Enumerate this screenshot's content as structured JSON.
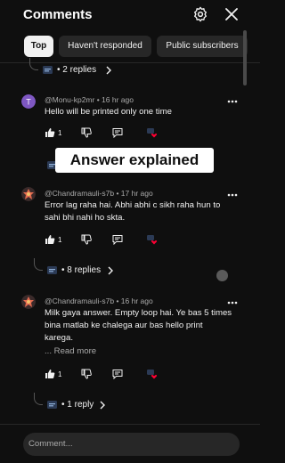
{
  "header": {
    "title": "Comments",
    "settings_icon": "gear-icon",
    "close_icon": "close-icon"
  },
  "tabs": [
    {
      "label": "Top"
    },
    {
      "label": "Haven't responded"
    },
    {
      "label": "Public subscribers"
    }
  ],
  "top_thread_replies": {
    "label": "• 2 replies"
  },
  "comments": [
    {
      "author": "@Monu-kp2mr",
      "time": "• 16 hr ago",
      "text": "Hello will be printed only one time",
      "likes": "1",
      "avatar_letter": "T",
      "avatar_color": "#7e57c2"
    },
    {
      "author": "@Chandramauli-s7b",
      "time": "• 17 hr ago",
      "text": "Error lag raha hai. Abhi abhi c sikh raha hun to sahi bhi nahi ho skta.",
      "likes": "1",
      "replies_label": "• 8 replies"
    },
    {
      "author": "@Chandramauli-s7b",
      "time": "• 16 hr ago",
      "text": "Milk gaya answer. Empty loop hai. Ye bas 5 times bina matlab ke chalega aur bas hello print karega.",
      "read_more": "... Read more",
      "likes": "1",
      "replies_label": "• 1 reply"
    }
  ],
  "overlay": {
    "text": "Answer explained"
  },
  "composer": {
    "placeholder": "Comment..."
  },
  "colors": {
    "background": "#0f0f0f",
    "chip_active": "#f1f1f1",
    "chip_inactive": "#272727",
    "heart": "#ff0033"
  }
}
